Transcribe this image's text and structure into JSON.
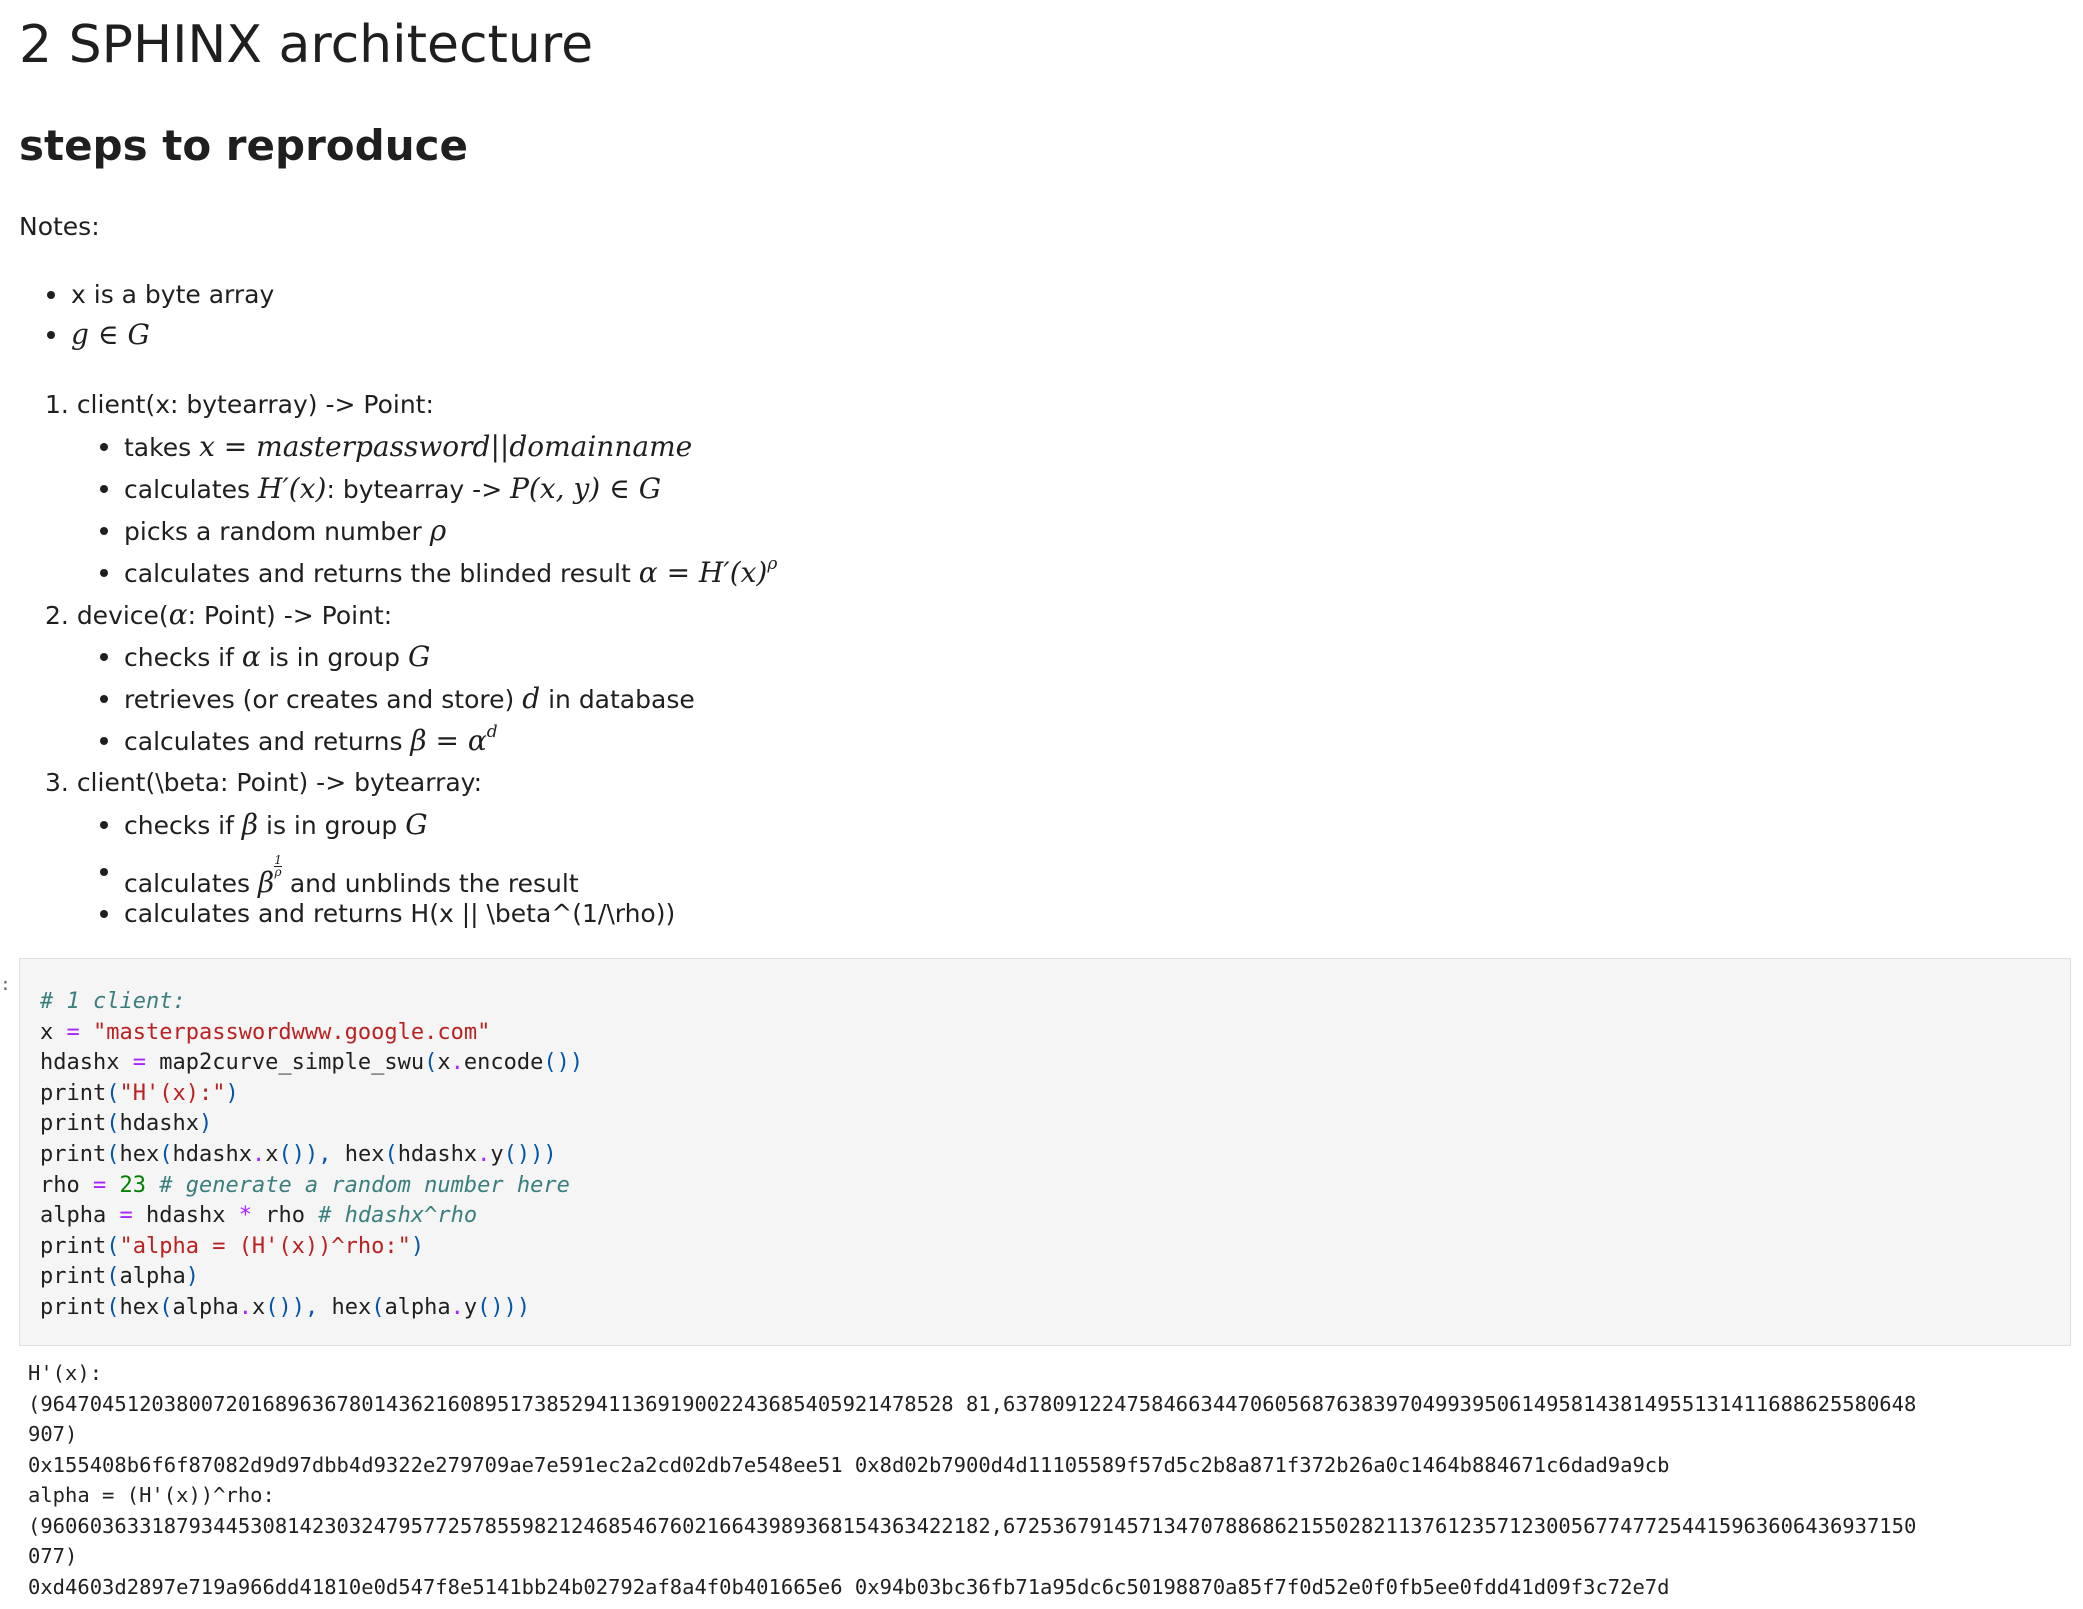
{
  "heading1": "2 SPHINX architecture",
  "heading2": "steps to reproduce",
  "notes_label": "Notes:",
  "notes": {
    "item1": "x is a byte array"
  },
  "steps": {
    "s1": {
      "title": "client(x: bytearray) -> Point:",
      "b1": "takes",
      "b2_pre": "calculates",
      "b2_mid": ": bytearray ->",
      "b3": "picks a random number",
      "b4": "calculates and returns the blinded result"
    },
    "s2": {
      "title_pre": "device(",
      "title_post": ": Point) -> Point:",
      "b1_pre": "checks if",
      "b1_post": "is in group",
      "b2_pre": "retrieves (or creates and store)",
      "b2_post": "in database",
      "b3": "calculates and returns"
    },
    "s3": {
      "title": "client(\\beta: Point) -> bytearray:",
      "b1_pre": "checks if",
      "b1_post": "is in group",
      "b2_pre": "calculates",
      "b2_post": "and unblinds the result",
      "b3": "calculates and returns H(x || \\beta^(1/\\rho))"
    }
  },
  "code": {
    "cell_marker": ":",
    "lines": [
      "# 1 client:",
      "x = \"masterpasswordwww.google.com\"",
      "hdashx = map2curve_simple_swu(x.encode())",
      "print(\"H'(x):\")",
      "print(hdashx)",
      "print(hex(hdashx.x()), hex(hdashx.y()))",
      "rho = 23 # generate a random number here",
      "alpha = hdashx * rho # hdashx^rho",
      "print(\"alpha = (H'(x))^rho:\")",
      "print(alpha)",
      "print(hex(alpha.x()), hex(alpha.y()))"
    ]
  },
  "output": {
    "lines": [
      "H'(x):",
      "(96470451203800720168963678014362160895173852941136919002243685405921478528 81,6378091224758466344706056876383970499395061495814381495513141168862558064 8",
      "907)",
      "0x155408b6f6f87082d9d97dbb4d9322e279709ae7e591ec2a2cd02db7e548ee51 0x8d02b7900d4d11105589f57d5c2b8a871f372b26a0c1464b884671c6dad9a9cb",
      "alpha = (H'(x))^rho:",
      "(96060363318793445308142303247957725785598212468546760216643989368154363422182,67253679145713470788686215502821137612357123005677477254415963606436937150",
      "077)",
      "0xd4603d2897e719a966dd41810e0d547f8e5141bb24b02792af8a4f0b401665e6 0x94b03bc36fb71a95dc6c50198870a85f7f0d52e0f0fb5ee0fdd41d09f3c72e7d"
    ]
  }
}
